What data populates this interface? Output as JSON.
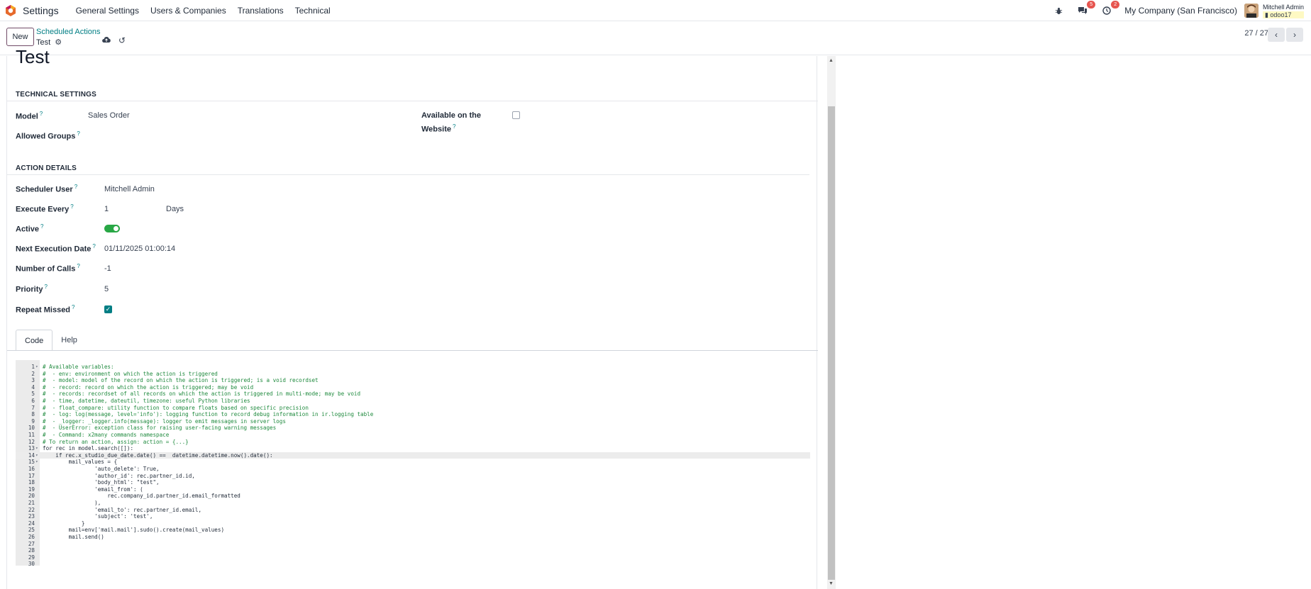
{
  "navbar": {
    "app_name": "Settings",
    "menu": [
      "General Settings",
      "Users & Companies",
      "Translations",
      "Technical"
    ],
    "chat_badge": "5",
    "activity_badge": "2",
    "company": "My Company (San Francisco)",
    "user_name": "Mitchell Admin",
    "database": "odoo17"
  },
  "control_panel": {
    "new_label": "New",
    "breadcrumb_parent": "Scheduled Actions",
    "breadcrumb_current": "Test",
    "pager": "27 / 27"
  },
  "form": {
    "title": "Test",
    "technical_settings": {
      "heading": "TECHNICAL SETTINGS",
      "model_label": "Model",
      "model_value": "Sales Order",
      "allowed_groups_label": "Allowed Groups",
      "website_label_line1": "Available on the",
      "website_label_line2": "Website",
      "website_checked": false
    },
    "action_details": {
      "heading": "ACTION DETAILS",
      "scheduler_user_label": "Scheduler User",
      "scheduler_user_value": "Mitchell Admin",
      "execute_every_label": "Execute Every",
      "execute_every_value": "1",
      "execute_every_unit": "Days",
      "active_label": "Active",
      "active": true,
      "next_exec_label": "Next Execution Date",
      "next_exec_value": "01/11/2025 01:00:14",
      "num_calls_label": "Number of Calls",
      "num_calls_value": "-1",
      "priority_label": "Priority",
      "priority_value": "5",
      "repeat_missed_label": "Repeat Missed",
      "repeat_missed": true
    },
    "tabs": [
      "Code",
      "Help"
    ],
    "code_lines": [
      "# Available variables:",
      "#  - env: environment on which the action is triggered",
      "#  - model: model of the record on which the action is triggered; is a void recordset",
      "#  - record: record on which the action is triggered; may be void",
      "#  - records: recordset of all records on which the action is triggered in multi-mode; may be void",
      "#  - time, datetime, dateutil, timezone: useful Python libraries",
      "#  - float_compare: utility function to compare floats based on specific precision",
      "#  - log: log(message, level='info'): logging function to record debug information in ir.logging table",
      "#  - _logger: _logger.info(message): logger to emit messages in server logs",
      "#  - UserError: exception class for raising user-facing warning messages",
      "#  - Command: x2many commands namespace",
      "# To return an action, assign: action = {...}",
      "for rec in model.search([]):",
      "    if rec.x_studio_due_date.date() ==  datetime.datetime.now().date():",
      "        mail_values = {",
      "                'auto_delete': True,",
      "                'author_id': rec.partner_id.id,",
      "                'body_html': \"test\",",
      "                'email_from': (",
      "                    rec.company_id.partner_id.email_formatted",
      "                ),",
      "                'email_to': rec.partner_id.email,",
      "                'subject': 'test',",
      "            }",
      "        mail=env['mail.mail'].sudo().create(mail_values)",
      "        mail.send()",
      "",
      "",
      "",
      ""
    ]
  }
}
